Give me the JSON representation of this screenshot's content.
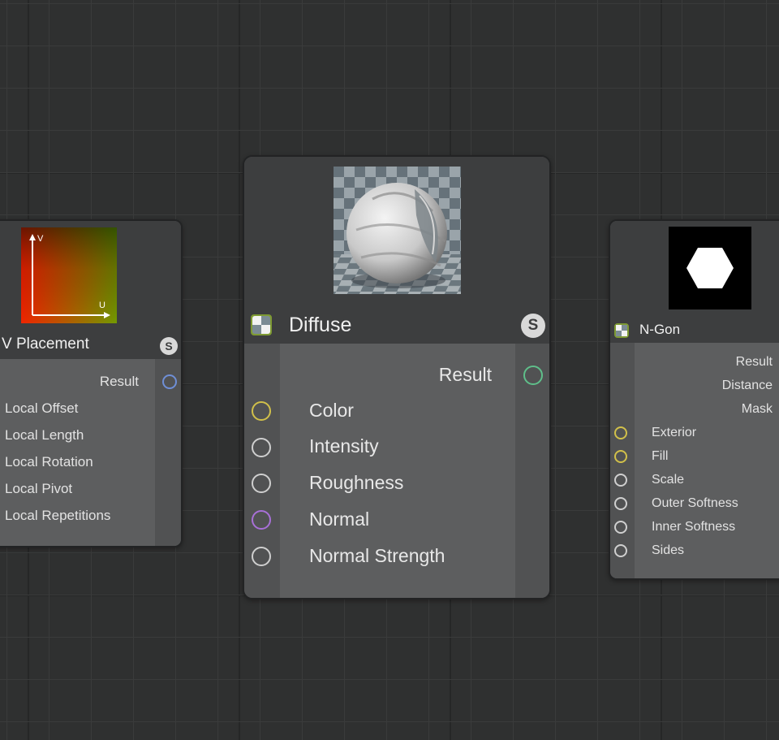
{
  "canvas": {
    "grid_color": "#3a3b3b",
    "background_color": "#2f3030"
  },
  "nodes": {
    "uv_placement": {
      "title": "V Placement",
      "badge": "S",
      "preview_axis_labels": {
        "v": "V",
        "u": "U"
      },
      "outputs": [
        {
          "label": "Result",
          "port_color": "#6f8fd6"
        }
      ],
      "inputs": [
        {
          "label": "Local Offset"
        },
        {
          "label": "Local Length"
        },
        {
          "label": "Local Rotation"
        },
        {
          "label": "Local Pivot"
        },
        {
          "label": "Local Repetitions"
        }
      ]
    },
    "diffuse": {
      "title": "Diffuse",
      "badge": "S",
      "type_icon": "material-checker-icon",
      "type_icon_color": "#8aa63b",
      "outputs": [
        {
          "label": "Result",
          "port_color": "#5fbf8a"
        }
      ],
      "inputs": [
        {
          "label": "Color",
          "port_color": "#d1c04a"
        },
        {
          "label": "Intensity",
          "port_color": "#cfcfcf"
        },
        {
          "label": "Roughness",
          "port_color": "#cfcfcf"
        },
        {
          "label": "Normal",
          "port_color": "#a870d8"
        },
        {
          "label": "Normal Strength",
          "port_color": "#cfcfcf"
        }
      ]
    },
    "n_gon": {
      "title": "N-Gon",
      "type_icon": "material-checker-icon",
      "outputs": [
        {
          "label": "Result"
        },
        {
          "label": "Distance"
        },
        {
          "label": "Mask"
        }
      ],
      "inputs": [
        {
          "label": "Exterior",
          "port_color": "#d1c04a"
        },
        {
          "label": "Fill",
          "port_color": "#d1c04a"
        },
        {
          "label": "Scale",
          "port_color": "#cfcfcf"
        },
        {
          "label": "Outer Softness",
          "port_color": "#cfcfcf"
        },
        {
          "label": "Inner Softness",
          "port_color": "#cfcfcf"
        },
        {
          "label": "Sides",
          "port_color": "#cfcfcf"
        }
      ]
    }
  }
}
